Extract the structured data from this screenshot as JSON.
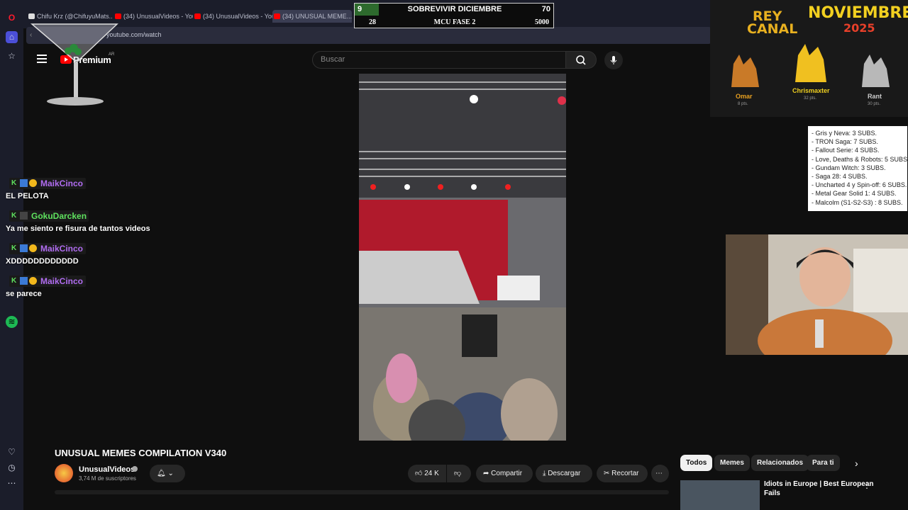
{
  "browser": {
    "tabs": [
      {
        "label": "Chifu Krz (@ChifuyuMats..."
      },
      {
        "label": "(34) UnusualVideos - You..."
      },
      {
        "label": "(34) UnusualVideos - You..."
      },
      {
        "label": "(34) UNUSUAL MEME..."
      }
    ],
    "url": "youtube.com/watch"
  },
  "youtube": {
    "logo_text": "Premium",
    "logo_region": "AR",
    "search_placeholder": "Buscar",
    "video_title": "UNUSUAL MEMES COMPILATION V340",
    "channel_name": "UnusualVideos",
    "subscribers": "3,74 M de suscriptores",
    "likes": "24 K",
    "share_label": "Compartir",
    "download_label": "Descargar",
    "clip_label": "Recortar",
    "chips": [
      "Todos",
      "Memes",
      "Relacionados",
      "Para ti"
    ],
    "rec_title_line1": "Idiots in Europe | Best European",
    "rec_title_line2": "Fails"
  },
  "scoreboard": {
    "row1_left": "9",
    "row1_title": "SOBREVIVIR DICIEMBRE",
    "row1_right": "70",
    "row2_left": "28",
    "row2_title": "MCU FASE 2",
    "row2_right": "5000"
  },
  "rey_canal": {
    "title_line1": "REY",
    "title_line2": "CANAL",
    "month": "NOVIEMBRE",
    "year": "2025",
    "ranks": [
      {
        "name": "Omar",
        "pts": "8 pts."
      },
      {
        "name": "Chrismaxter",
        "pts": "32 pts."
      },
      {
        "name": "Rant",
        "pts": "30 pts."
      }
    ]
  },
  "subs_list": [
    "- Gris y Neva: 3 SUBS.",
    "- TRON Saga: 7 SUBS.",
    "- Fallout Serie: 4 SUBS.",
    "- Love, Deaths & Robots: 5 SUBS.",
    "- Gundam Witch: 3 SUBS.",
    "- Saga 28: 4 SUBS.",
    "- Uncharted 4 y Spin-off: 6 SUBS.",
    "- Metal Gear Solid 1: 4 SUBS.",
    "- Malcolm (S1-S2-S3) : 8 SUBS."
  ],
  "chat": [
    {
      "user": "MaikCinco",
      "color": "#b06cf0",
      "message": "EL PELOTA"
    },
    {
      "user": "GokuDarcken",
      "color": "#5fe35f",
      "message": "Ya me siento re fisura de tantos videos"
    },
    {
      "user": "MaikCinco",
      "color": "#b06cf0",
      "message": "XDDDDDDDDDDDD"
    },
    {
      "user": "MaikCinco",
      "color": "#b06cf0",
      "message": "se parece"
    }
  ]
}
